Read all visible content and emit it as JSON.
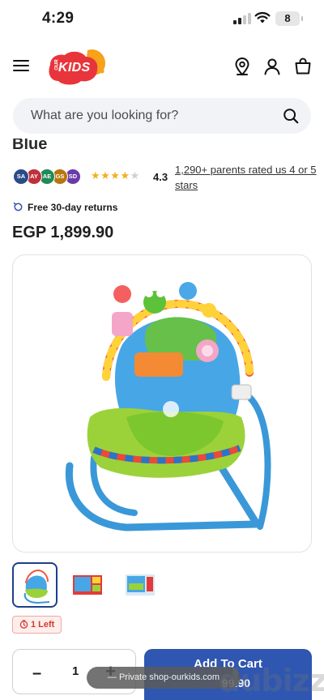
{
  "status_bar": {
    "time": "4:29",
    "battery": "8"
  },
  "header": {
    "logo_small": "OUR",
    "logo_text": "KIDS"
  },
  "search": {
    "placeholder": "What are you looking for?"
  },
  "product": {
    "title_fragment": "Blue",
    "reviewers": [
      {
        "initials": "SA",
        "color": "#2a4a8a"
      },
      {
        "initials": "AY",
        "color": "#c0303a"
      },
      {
        "initials": "AE",
        "color": "#1f8a57"
      },
      {
        "initials": "GS",
        "color": "#b7760f"
      },
      {
        "initials": "SD",
        "color": "#6a3aa8"
      }
    ],
    "rating": "4.3",
    "rating_stars": 4.3,
    "rated_text": "1,290+ parents rated us 4 or 5 stars",
    "returns": "Free 30-day returns",
    "price": "EGP 1,899.90",
    "stock": "1 Left"
  },
  "cart": {
    "quantity": "1",
    "minus": "–",
    "plus": "+",
    "add_label": "Add To Cart",
    "price_fragment": "99.90"
  },
  "browser": {
    "private_label": "— Private shop-ourkids.com"
  },
  "overlay": {
    "watermark": "dubizzle"
  }
}
